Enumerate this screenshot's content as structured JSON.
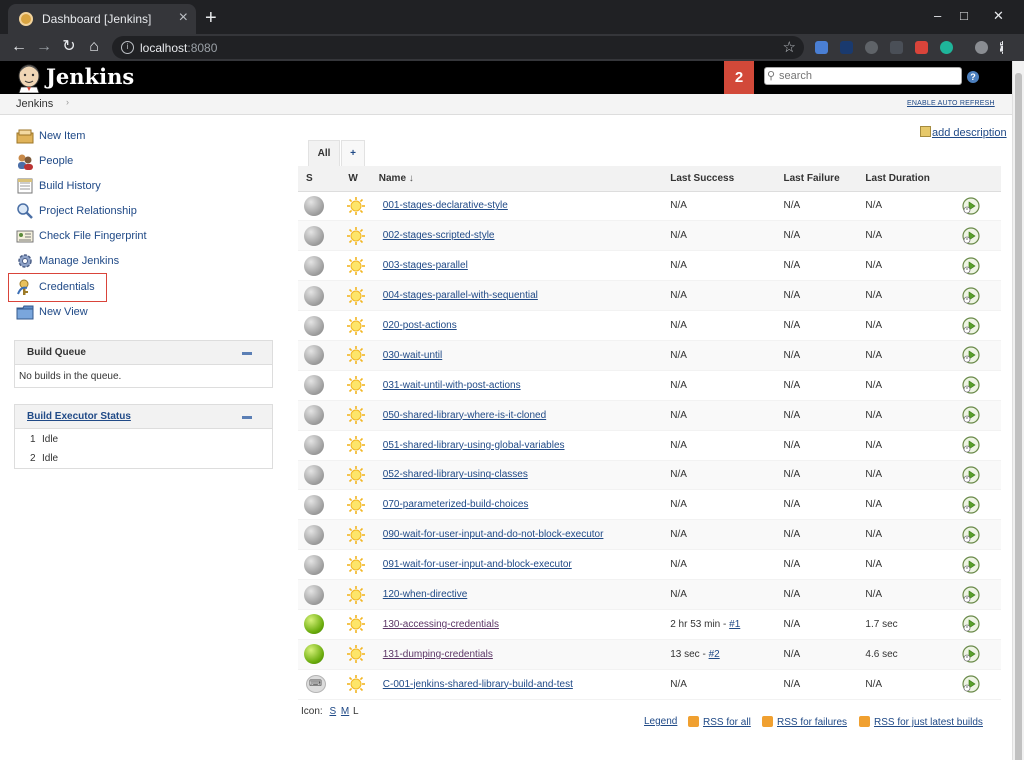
{
  "browser": {
    "tab_title": "Dashboard [Jenkins]",
    "close_glyph": "×",
    "newtab_glyph": "+",
    "url_host": "localhost",
    "url_port": ":8080",
    "back_glyph": "←",
    "forward_glyph": "→",
    "reload_glyph": "↻",
    "home_glyph": "⌂",
    "star_glyph": "☆",
    "minimize_glyph": "–",
    "maximize_glyph": "□",
    "window_close_glyph": "✕"
  },
  "header": {
    "logo_text": "Jenkins",
    "notification_count": "2",
    "search_placeholder": "search",
    "help_glyph": "?",
    "search_glyph": "⚲"
  },
  "breadcrumb": {
    "root": "Jenkins",
    "arrow": "›",
    "auto_refresh": "ENABLE AUTO REFRESH"
  },
  "tasks": [
    {
      "label": "New Item",
      "icon": "new-item-icon"
    },
    {
      "label": "People",
      "icon": "people-icon"
    },
    {
      "label": "Build History",
      "icon": "build-history-icon"
    },
    {
      "label": "Project Relationship",
      "icon": "search-icon"
    },
    {
      "label": "Check File Fingerprint",
      "icon": "fingerprint-icon"
    },
    {
      "label": "Manage Jenkins",
      "icon": "gear-icon"
    },
    {
      "label": "Credentials",
      "icon": "credentials-icon"
    },
    {
      "label": "New View",
      "icon": "folder-icon"
    }
  ],
  "build_queue": {
    "title": "Build Queue",
    "empty_text": "No builds in the queue."
  },
  "executor_status": {
    "title": "Build Executor Status",
    "executors": [
      {
        "num": "1",
        "state": "Idle"
      },
      {
        "num": "2",
        "state": "Idle"
      }
    ]
  },
  "views": {
    "active": "All",
    "add": "+"
  },
  "add_description": "add description",
  "table": {
    "headers": {
      "s": "S",
      "w": "W",
      "name": "Name",
      "sort_arrow": "↓",
      "last_success": "Last Success",
      "last_failure": "Last Failure",
      "last_duration": "Last Duration"
    },
    "jobs": [
      {
        "name": "001-stages-declarative-style",
        "status": "grey",
        "last_success": "N/A",
        "build": "",
        "last_failure": "N/A",
        "last_duration": "N/A"
      },
      {
        "name": "002-stages-scripted-style",
        "status": "grey",
        "last_success": "N/A",
        "build": "",
        "last_failure": "N/A",
        "last_duration": "N/A"
      },
      {
        "name": "003-stages-parallel",
        "status": "grey",
        "last_success": "N/A",
        "build": "",
        "last_failure": "N/A",
        "last_duration": "N/A"
      },
      {
        "name": "004-stages-parallel-with-sequential",
        "status": "grey",
        "last_success": "N/A",
        "build": "",
        "last_failure": "N/A",
        "last_duration": "N/A"
      },
      {
        "name": "020-post-actions",
        "status": "grey",
        "last_success": "N/A",
        "build": "",
        "last_failure": "N/A",
        "last_duration": "N/A"
      },
      {
        "name": "030-wait-until",
        "status": "grey",
        "last_success": "N/A",
        "build": "",
        "last_failure": "N/A",
        "last_duration": "N/A"
      },
      {
        "name": "031-wait-until-with-post-actions",
        "status": "grey",
        "last_success": "N/A",
        "build": "",
        "last_failure": "N/A",
        "last_duration": "N/A"
      },
      {
        "name": "050-shared-library-where-is-it-cloned",
        "status": "grey",
        "last_success": "N/A",
        "build": "",
        "last_failure": "N/A",
        "last_duration": "N/A"
      },
      {
        "name": "051-shared-library-using-global-variables",
        "status": "grey",
        "last_success": "N/A",
        "build": "",
        "last_failure": "N/A",
        "last_duration": "N/A"
      },
      {
        "name": "052-shared-library-using-classes",
        "status": "grey",
        "last_success": "N/A",
        "build": "",
        "last_failure": "N/A",
        "last_duration": "N/A"
      },
      {
        "name": "070-parameterized-build-choices",
        "status": "grey",
        "last_success": "N/A",
        "build": "",
        "last_failure": "N/A",
        "last_duration": "N/A"
      },
      {
        "name": "090-wait-for-user-input-and-do-not-block-executor",
        "status": "grey",
        "last_success": "N/A",
        "build": "",
        "last_failure": "N/A",
        "last_duration": "N/A"
      },
      {
        "name": "091-wait-for-user-input-and-block-executor",
        "status": "grey",
        "last_success": "N/A",
        "build": "",
        "last_failure": "N/A",
        "last_duration": "N/A"
      },
      {
        "name": "120-when-directive",
        "status": "grey",
        "last_success": "N/A",
        "build": "",
        "last_failure": "N/A",
        "last_duration": "N/A"
      },
      {
        "name": "130-accessing-credentials",
        "status": "blue",
        "last_success": "2 hr 53 min - ",
        "build": "#1",
        "last_failure": "N/A",
        "last_duration": "1.7 sec"
      },
      {
        "name": "131-dumping-credentials",
        "status": "blue",
        "last_success": "13 sec - ",
        "build": "#2",
        "last_failure": "N/A",
        "last_duration": "4.6 sec"
      },
      {
        "name": "C-001-jenkins-shared-library-build-and-test",
        "status": "folder",
        "last_success": "N/A",
        "build": "",
        "last_failure": "N/A",
        "last_duration": "N/A"
      }
    ]
  },
  "icon_size": {
    "label": "Icon:",
    "s": "S",
    "m": "M",
    "l": "L"
  },
  "footer": {
    "legend": "Legend",
    "rss_all": "RSS for all",
    "rss_failures": "RSS for failures",
    "rss_latest": "RSS for just latest builds"
  }
}
